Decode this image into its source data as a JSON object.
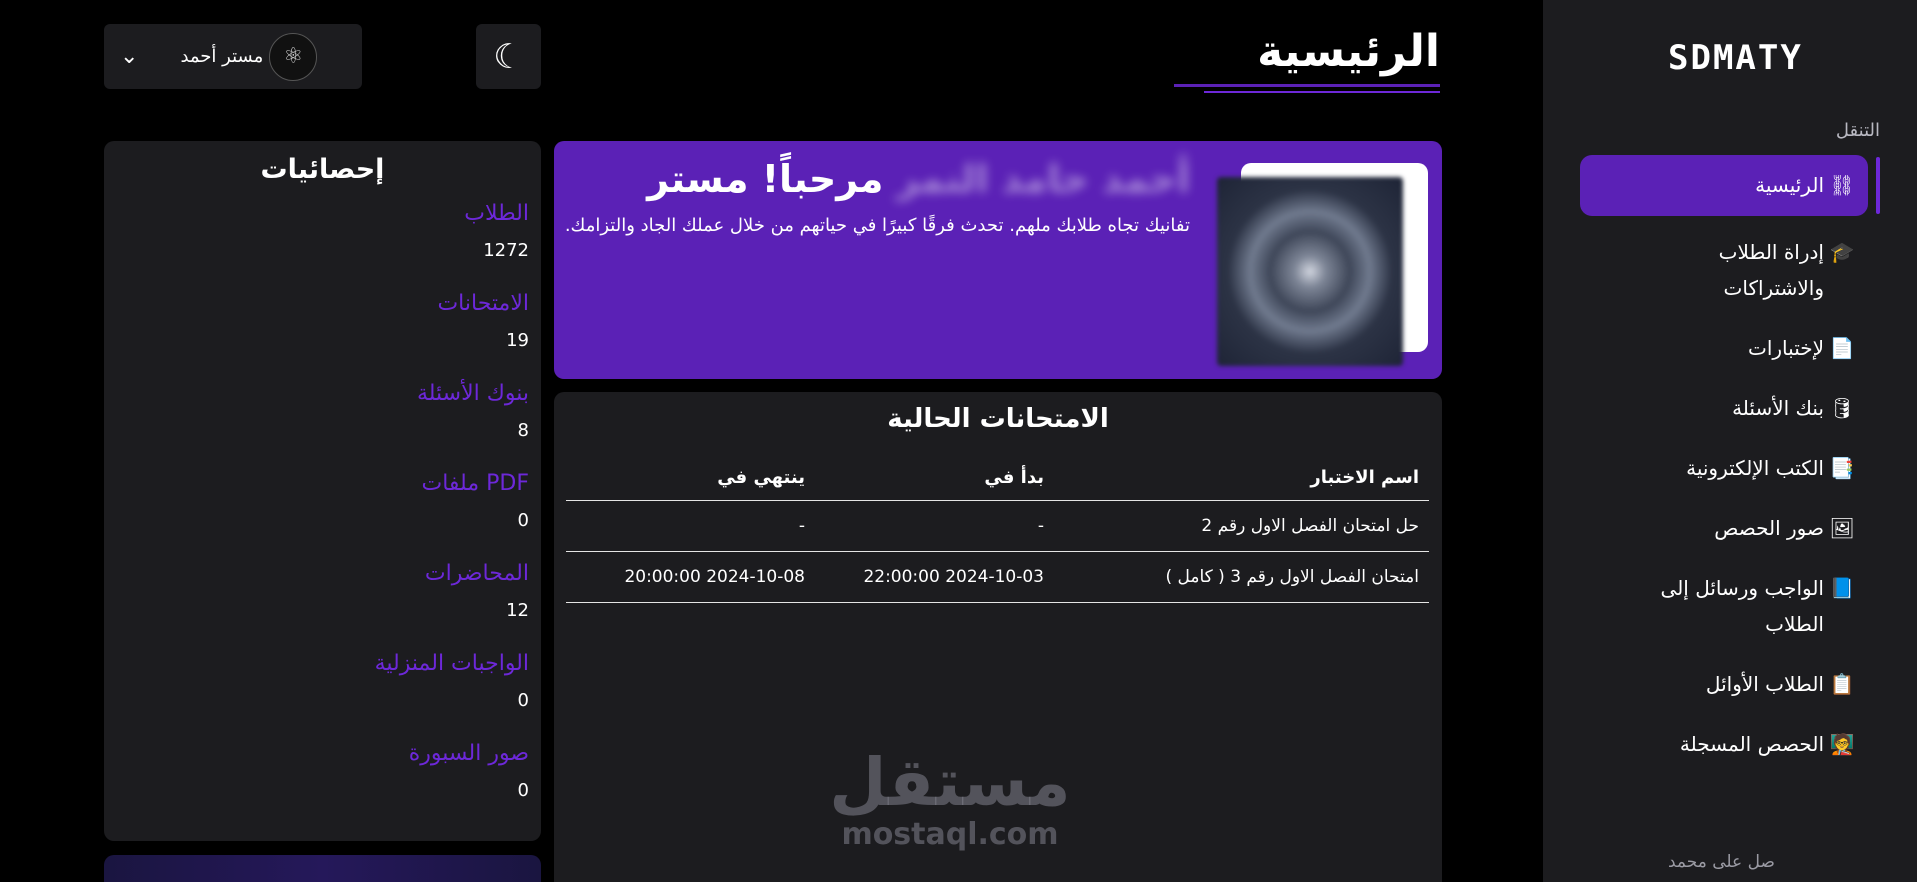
{
  "sidebar": {
    "logo": "SDMATY",
    "nav_heading": "التنقل",
    "items": [
      {
        "label": "الرئيسية",
        "icon": "graph-nodes-icon",
        "glyph": "⛓",
        "active": true
      },
      {
        "label": "إدراة الطلاب والاشتراكات",
        "icon": "graduate-user-icon",
        "glyph": "🎓",
        "active": false
      },
      {
        "label": "لإختبارات",
        "icon": "file-text-icon",
        "glyph": "📄",
        "active": false
      },
      {
        "label": "بنك الأسئلة",
        "icon": "database-icon",
        "glyph": "🛢",
        "active": false
      },
      {
        "label": "الكتب الإلكترونية",
        "icon": "pdf-file-icon",
        "glyph": "📑",
        "active": false
      },
      {
        "label": "صور الحصص",
        "icon": "image-icon",
        "glyph": "🖼",
        "active": false
      },
      {
        "label": "الواجب ورسائل إلى الطلاب",
        "icon": "book-icon",
        "glyph": "📘",
        "active": false
      },
      {
        "label": "الطلاب الأوائل",
        "icon": "clipboard-list-icon",
        "glyph": "📋",
        "active": false
      },
      {
        "label": "الحصص المسجلة",
        "icon": "chalkboard-teacher-icon",
        "glyph": "🧑‍🏫",
        "active": false
      }
    ],
    "bottom_note": "صل على محمد"
  },
  "header": {
    "title": "الرئيسية",
    "theme_toggle_glyph": "☾",
    "user_name": "مستر أحمد",
    "user_chevron": "⌄",
    "avatar_glyph": "⚛"
  },
  "stats": {
    "title": "إحصائيات",
    "items": [
      {
        "label": "الطلاب",
        "value": "1272"
      },
      {
        "label": "الامتحانات",
        "value": "19"
      },
      {
        "label": "بنوك الأسئلة",
        "value": "8"
      },
      {
        "label": "ملفات PDF",
        "value": "0"
      },
      {
        "label": "المحاضرات",
        "value": "12"
      },
      {
        "label": "الواجبات المنزلية",
        "value": "0"
      },
      {
        "label": "صور السبورة",
        "value": "0"
      }
    ]
  },
  "welcome": {
    "greeting": "مرحباً! مستر",
    "name_blurred": "أحمد حامد النمر",
    "message": "تفانيك تجاه طلابك ملهم. تحدث فرقًا كبيرًا في حياتهم من خلال عملك الجاد والتزامك."
  },
  "exams": {
    "title": "الامتحانات الحالية",
    "columns": [
      "اسم الاختبار",
      "بدأ في",
      "ينتهي في"
    ],
    "rows": [
      [
        "حل امتحان الفصل الاول رقم 2",
        "-",
        "-"
      ],
      [
        "امتحان الفصل الاول رقم 3 ( كامل )",
        "2024-10-03 22:00:00",
        "2024-10-08 20:00:00"
      ]
    ]
  },
  "watermark": {
    "arabic": "مستقل",
    "latin": "mostaql.com"
  },
  "colors": {
    "accent": "#5b21b6",
    "accent_text": "#6d28d9",
    "panel": "#1c1c1f",
    "background": "#000000"
  }
}
